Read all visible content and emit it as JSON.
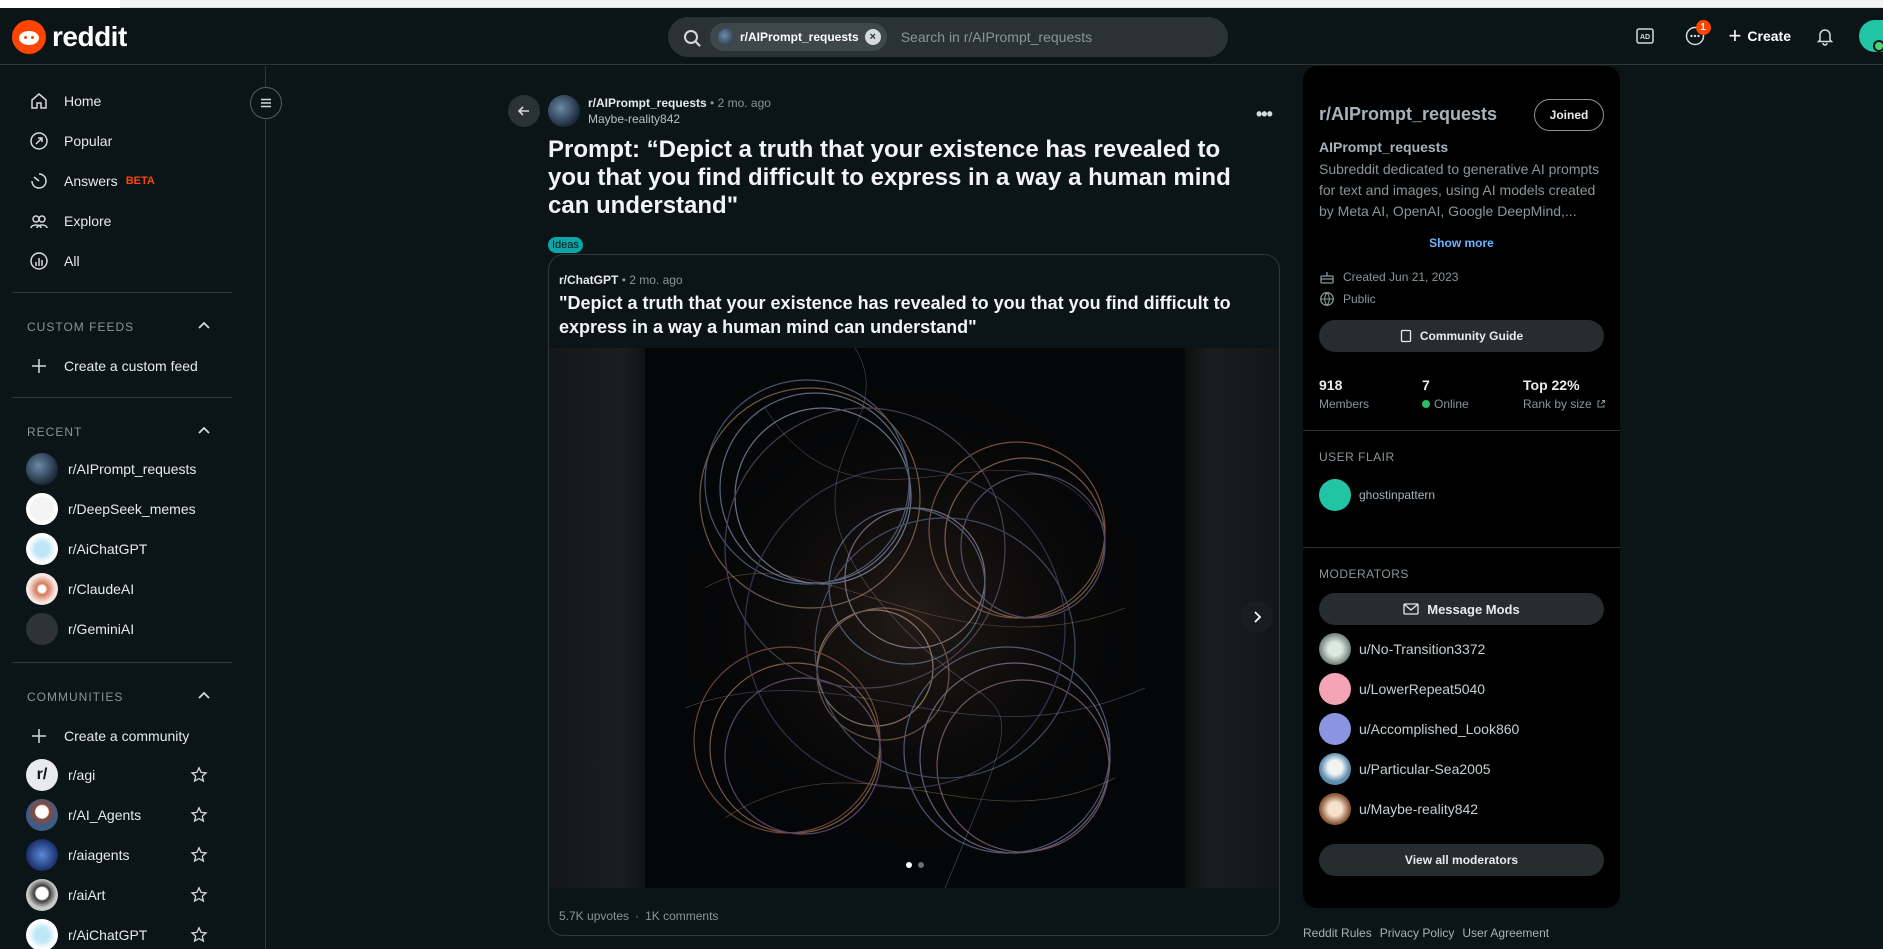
{
  "header": {
    "logo_text": "reddit",
    "search_chip": "r/AIPrompt_requests",
    "search_placeholder": "Search in r/AIPrompt_requests",
    "chat_badge": "1",
    "create_label": "Create"
  },
  "sidebar": {
    "nav": [
      {
        "label": "Home",
        "icon": "home-icon"
      },
      {
        "label": "Popular",
        "icon": "popular-icon"
      },
      {
        "label": "Answers",
        "badge": "BETA",
        "icon": "answers-icon"
      },
      {
        "label": "Explore",
        "icon": "explore-icon"
      },
      {
        "label": "All",
        "icon": "all-icon"
      }
    ],
    "custom_feeds_title": "CUSTOM FEEDS",
    "create_feed": "Create a custom feed",
    "recent_title": "RECENT",
    "recent": [
      "r/AIPrompt_requests",
      "r/DeepSeek_memes",
      "r/AiChatGPT",
      "r/ClaudeAI",
      "r/GeminiAI"
    ],
    "communities_title": "COMMUNITIES",
    "create_community": "Create a community",
    "communities": [
      "r/agi",
      "r/AI_Agents",
      "r/aiagents",
      "r/aiArt",
      "r/AiChatGPT"
    ]
  },
  "post": {
    "subreddit": "r/AIPrompt_requests",
    "time": "• 2 mo. ago",
    "author": "Maybe-reality842",
    "title": "Prompt: “Depict a truth that your existence has revealed to you that you find difficult to express in a way a human mind can understand\"",
    "flair": "Ideas",
    "embed": {
      "subreddit": "r/ChatGPT",
      "time": "• 2 mo. ago",
      "title": "\"Depict a truth that your existence has revealed to you that you find difficult to express in a way a human mind can understand\"",
      "upvotes": "5.7K upvotes",
      "separator": "·",
      "comments": "1K comments"
    }
  },
  "rail": {
    "name": "r/AIPrompt_requests",
    "joined": "Joined",
    "title": "AIPrompt_requests",
    "description": "Subreddit dedicated to generative AI prompts for text and images, using AI models created by Meta AI, OpenAI, Google DeepMind,...",
    "show_more": "Show more",
    "created": "Created Jun 21, 2023",
    "visibility": "Public",
    "guide": "Community Guide",
    "members_value": "918",
    "members_label": "Members",
    "online_value": "7",
    "online_label": "Online",
    "rank_value": "Top 22%",
    "rank_label": "Rank by size",
    "user_flair_title": "USER FLAIR",
    "flair_user": "ghostinpattern",
    "moderators_title": "MODERATORS",
    "message_mods": "Message Mods",
    "moderators": [
      "u/No-Transition3372",
      "u/LowerRepeat5040",
      "u/Accomplished_Look860",
      "u/Particular-Sea2005",
      "u/Maybe-reality842"
    ],
    "view_all": "View all moderators"
  },
  "footer": [
    "Reddit Rules",
    "Privacy Policy",
    "User Agreement"
  ]
}
